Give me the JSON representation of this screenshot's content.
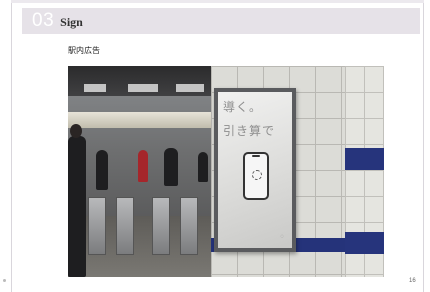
{
  "header": {
    "section_number": "03",
    "section_title": "Sign"
  },
  "caption": "駅内広告",
  "photo": {
    "poster": {
      "line1": "導く。",
      "line2": "引き算で",
      "loader_icon": "loader-icon",
      "logo_icon": "brand-mark-icon"
    }
  },
  "page_number": "16",
  "colors": {
    "header_bg": "#e6e2e8",
    "tile_blue": "#26347c"
  }
}
